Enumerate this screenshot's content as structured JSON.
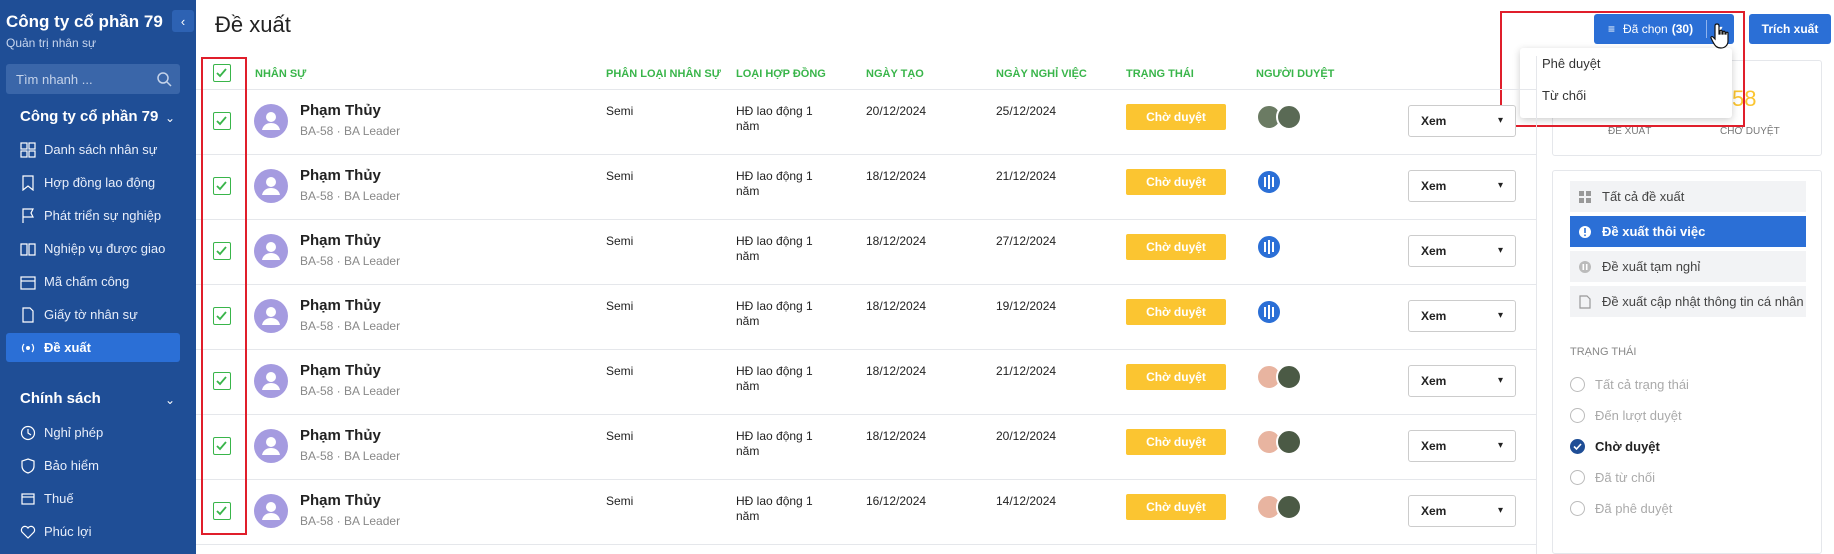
{
  "sidebar": {
    "company": "Công ty cổ phần 79",
    "subtitle": "Quản trị nhân sự",
    "search_placeholder": "Tìm nhanh ...",
    "groups": [
      {
        "title": "Công ty cổ phần 79"
      },
      {
        "title": "Chính sách"
      }
    ],
    "items": [
      {
        "label": "Danh sách nhân sự",
        "icon": "grid-icon"
      },
      {
        "label": "Hợp đồng lao động",
        "icon": "bookmark-icon"
      },
      {
        "label": "Phát triển sự nghiệp",
        "icon": "flag-icon"
      },
      {
        "label": "Nghiệp vụ được giao",
        "icon": "book-icon"
      },
      {
        "label": "Mã chấm công",
        "icon": "calendar-icon"
      },
      {
        "label": "Giấy tờ nhân sự",
        "icon": "document-icon"
      },
      {
        "label": "Đề xuất",
        "icon": "broadcast-icon"
      },
      {
        "label": "Nghỉ phép",
        "icon": "clock-icon"
      },
      {
        "label": "Bảo hiểm",
        "icon": "shield-icon"
      },
      {
        "label": "Thuế",
        "icon": "receipt-icon"
      },
      {
        "label": "Phúc lợi",
        "icon": "heart-icon"
      }
    ]
  },
  "header": {
    "title": "Đề xuất",
    "selected_label": "Đã chọn",
    "selected_count": "(30)",
    "export_label": "Trích xuất"
  },
  "dropdown": {
    "items": [
      "Phê duyệt",
      "Từ chối"
    ]
  },
  "table": {
    "columns": [
      "NHÂN SỰ",
      "PHÂN LOẠI NHÂN SỰ",
      "LOẠI HỢP ĐỒNG",
      "NGÀY TẠO",
      "NGÀY NGHỈ VIỆC",
      "TRẠNG THÁI",
      "NGƯỜI DUYỆT"
    ],
    "rows": [
      {
        "name": "Phạm Thủy",
        "sub": "BA-58 · BA Leader",
        "type": "Semi",
        "contract_1": "HĐ lao động 1",
        "contract_2": "năm",
        "created": "20/12/2024",
        "leave": "25/12/2024",
        "status": "Chờ duyệt",
        "action": "Xem"
      },
      {
        "name": "Phạm Thủy",
        "sub": "BA-58 · BA Leader",
        "type": "Semi",
        "contract_1": "HĐ lao động 1",
        "contract_2": "năm",
        "created": "18/12/2024",
        "leave": "21/12/2024",
        "status": "Chờ duyệt",
        "action": "Xem"
      },
      {
        "name": "Phạm Thủy",
        "sub": "BA-58 · BA Leader",
        "type": "Semi",
        "contract_1": "HĐ lao động 1",
        "contract_2": "năm",
        "created": "18/12/2024",
        "leave": "27/12/2024",
        "status": "Chờ duyệt",
        "action": "Xem"
      },
      {
        "name": "Phạm Thủy",
        "sub": "BA-58 · BA Leader",
        "type": "Semi",
        "contract_1": "HĐ lao động 1",
        "contract_2": "năm",
        "created": "18/12/2024",
        "leave": "19/12/2024",
        "status": "Chờ duyệt",
        "action": "Xem"
      },
      {
        "name": "Phạm Thủy",
        "sub": "BA-58 · BA Leader",
        "type": "Semi",
        "contract_1": "HĐ lao động 1",
        "contract_2": "năm",
        "created": "18/12/2024",
        "leave": "21/12/2024",
        "status": "Chờ duyệt",
        "action": "Xem"
      },
      {
        "name": "Phạm Thủy",
        "sub": "BA-58 · BA Leader",
        "type": "Semi",
        "contract_1": "HĐ lao động 1",
        "contract_2": "năm",
        "created": "18/12/2024",
        "leave": "20/12/2024",
        "status": "Chờ duyệt",
        "action": "Xem"
      },
      {
        "name": "Phạm Thủy",
        "sub": "BA-58 · BA Leader",
        "type": "Semi",
        "contract_1": "HĐ lao động 1",
        "contract_2": "năm",
        "created": "16/12/2024",
        "leave": "14/12/2024",
        "status": "Chờ duyệt",
        "action": "Xem"
      }
    ]
  },
  "stats": {
    "left_label": "ĐỀ XUẤT",
    "right_label": "CHỜ DUYỆT",
    "right_value": "58"
  },
  "filters": {
    "categories": [
      "Tất cả đề xuất",
      "Đề xuất thôi việc",
      "Đề xuất tạm nghỉ",
      "Đề xuất cập nhật thông tin cá nhân"
    ],
    "status_title": "TRẠNG THÁI",
    "statuses": [
      "Tất cả trạng thái",
      "Đến lượt duyệt",
      "Chờ duyệt",
      "Đã từ chối",
      "Đã phê duyệt"
    ]
  },
  "colors": {
    "sidebar": "#1f4e96",
    "accent": "#2b6fd6",
    "header_green": "#39b54a",
    "status_yellow": "#fbc531",
    "highlight_red": "#e01e2b"
  }
}
